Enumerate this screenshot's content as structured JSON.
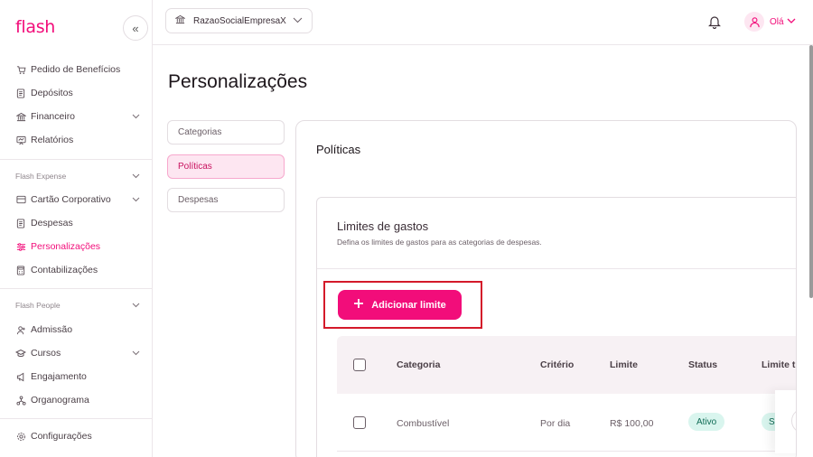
{
  "brand": {
    "logo_text": "flash",
    "accent": "#f20d7a"
  },
  "sidebar": {
    "collapse_icon": "«",
    "items": [
      {
        "label": "Pedido de Benefícios",
        "icon": "cart-icon"
      },
      {
        "label": "Depósitos",
        "icon": "receipt-icon"
      },
      {
        "label": "Financeiro",
        "icon": "bank-icon",
        "has_chevron": true
      },
      {
        "label": "Relatórios",
        "icon": "report-icon"
      }
    ],
    "sections": [
      {
        "label": "Flash Expense",
        "items": [
          {
            "label": "Cartão Corporativo",
            "icon": "card-icon",
            "has_chevron": true
          },
          {
            "label": "Despesas",
            "icon": "receipt-icon"
          },
          {
            "label": "Personalizações",
            "icon": "sliders-icon",
            "active": true
          },
          {
            "label": "Contabilizações",
            "icon": "calculator-icon"
          }
        ]
      },
      {
        "label": "Flash People",
        "items": [
          {
            "label": "Admissão",
            "icon": "user-plus-icon"
          },
          {
            "label": "Cursos",
            "icon": "graduation-icon",
            "has_chevron": true
          },
          {
            "label": "Engajamento",
            "icon": "megaphone-icon"
          },
          {
            "label": "Organograma",
            "icon": "org-chart-icon"
          }
        ]
      }
    ],
    "footer": {
      "label": "Configurações",
      "icon": "gear-icon"
    }
  },
  "topbar": {
    "company_name": "RazaoSocialEmpresaX",
    "greeting": "Olá"
  },
  "main": {
    "title": "Personalizações",
    "tabs": [
      "Categorias",
      "Políticas",
      "Despesas"
    ],
    "active_tab": 1,
    "panel_title": "Políticas",
    "card": {
      "title": "Limites de gastos",
      "description": "Defina os limites de gastos para as categorias de despesas.",
      "add_button": "Adicionar limite"
    },
    "table": {
      "headers": [
        "Categoria",
        "Critério",
        "Limite",
        "Status",
        "Limite trav"
      ],
      "rows": [
        {
          "categoria": "Combustível",
          "criterio": "Por dia",
          "limite": "R$ 100,00",
          "status": "Ativo",
          "travado": "Si"
        }
      ]
    }
  },
  "colors": {
    "badge_bg": "#d9f5ee",
    "highlight_border": "#d41a2a"
  }
}
